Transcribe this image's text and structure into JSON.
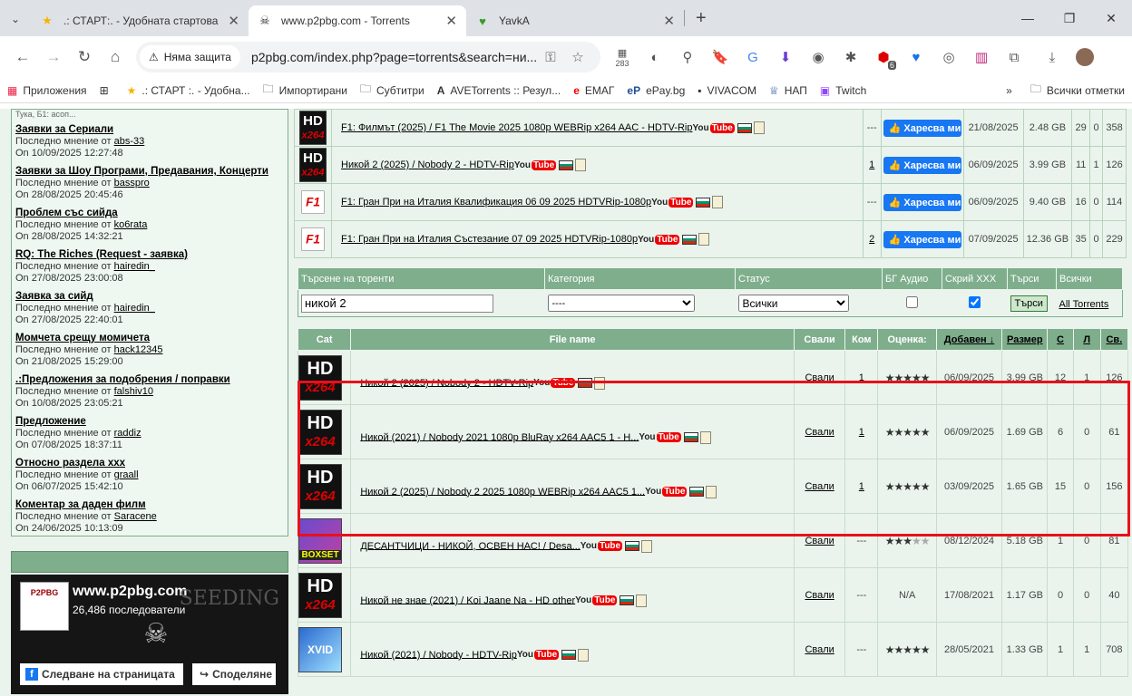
{
  "tabs": [
    {
      "title": ".: СТАРТ:. - Удобната стартова",
      "icon": "star-icon"
    },
    {
      "title": "www.p2pbg.com - Torrents",
      "icon": "pirate-icon"
    },
    {
      "title": "YavkA",
      "icon": "yavka-icon"
    }
  ],
  "toolbar": {
    "security": "Няма защита",
    "url": "p2pbg.com/index.php?page=torrents&search=ни...",
    "ext_badge_1": "283",
    "ext_badge_2": "6"
  },
  "bookmarks": [
    "Приложения",
    ".: СТАРТ :. - Удобна...",
    "Импортирани",
    "Субтитри",
    "AVETorrents :: Резул...",
    "ЕМАГ",
    "ePay.bg",
    "VIVACOM",
    "НАП",
    "Twitch",
    "Всички отметки"
  ],
  "forum": [
    {
      "title": "Заявки за Сериали",
      "prefix": "Последно мнение от",
      "user": "abs-33",
      "date": "On 10/09/2025 12:27:48"
    },
    {
      "title": "Заявки за Шоу Програми, Предавания, Концерти",
      "prefix": "Последно мнение от",
      "user": "basspro",
      "date": "On 28/08/2025 20:45:46"
    },
    {
      "title": "Проблем със сийда",
      "prefix": "Последно мнение от",
      "user": "ko6rata",
      "date": "On 28/08/2025 14:32:21"
    },
    {
      "title": "RQ: The Riches (Request - заявка)",
      "prefix": "Последно мнение от",
      "user": "hairedin_",
      "date": "On 27/08/2025 23:00:08"
    },
    {
      "title": "Заявка за сийд",
      "prefix": "Последно мнение от",
      "user": "hairedin_",
      "date": "On 27/08/2025 22:40:01"
    },
    {
      "title": "Момчета срещу момичета",
      "prefix": "Последно мнение от",
      "user": "hack12345",
      "date": "On 21/08/2025 15:29:00"
    },
    {
      "title": ".:Предложения за подобрения / поправки",
      "prefix": "Последно мнение от",
      "user": "falshiv10",
      "date": "On 10/08/2025 23:05:21"
    },
    {
      "title": "Предложение",
      "prefix": "Последно мнение от",
      "user": "raddiz",
      "date": "On 07/08/2025 18:37:11"
    },
    {
      "title": "Относно раздела ххх",
      "prefix": "Последно мнение от",
      "user": "graall",
      "date": "On 06/07/2025 15:42:10"
    },
    {
      "title": "Коментар за даден филм",
      "prefix": "Последно мнение от",
      "user": "Saracene",
      "date": "On 24/06/2025 10:13:09"
    }
  ],
  "fb": {
    "site": "www.p2pbg.com",
    "followers": "26,486 последователи",
    "follow": "Следване на страницата",
    "share": "Споделяне",
    "seeding": "SEEDING"
  },
  "top_rows": [
    {
      "name": "F1: Филмът (2025) / F1 The Movie 2025 1080p WEBRip x264 AAC - HDTV-Rip",
      "com": "---",
      "like": "Харесва ми",
      "date": "21/08/2025",
      "size": "2.48 GB",
      "s": "29",
      "l": "0",
      "d": "358",
      "cat": "hd"
    },
    {
      "name": "Никой 2 (2025) / Nobody 2 - HDTV-Rip",
      "com": "1",
      "like": "Харесва ми",
      "date": "06/09/2025",
      "size": "3.99 GB",
      "s": "11",
      "l": "1",
      "d": "126",
      "cat": "hd"
    },
    {
      "name": "F1: Гран При на Италия Квалификация 06 09 2025 HDTVRip-1080p",
      "com": "---",
      "like": "Харесва ми",
      "date": "06/09/2025",
      "size": "9.40 GB",
      "s": "16",
      "l": "0",
      "d": "114",
      "cat": "f1"
    },
    {
      "name": "F1: Гран При на Италия Състезание 07 09 2025 HDTVRip-1080p",
      "com": "2",
      "like": "Харесва ми",
      "date": "07/09/2025",
      "size": "12.36 GB",
      "s": "35",
      "l": "0",
      "d": "229",
      "cat": "f1"
    }
  ],
  "search": {
    "headers": [
      "Търсене на торенти",
      "Категория",
      "Статус",
      "БГ Аудио",
      "Скрий XXX",
      "Търси",
      "Всички"
    ],
    "query": "никой 2",
    "category": "----",
    "status": "Всички",
    "bg_audio": false,
    "hide_xxx": true,
    "button": "Търси",
    "all": "All Torrents"
  },
  "results_headers": [
    "Cat",
    "File name",
    "Свали",
    "Ком",
    "Оценка:",
    "Добавен ↓",
    "Размер",
    "С",
    "Л",
    "Св."
  ],
  "results": [
    {
      "cat": "hd",
      "name": "Никой 2 (2025) / Nobody 2 - HDTV-Rip",
      "dl": "Свали",
      "com": "1",
      "rating": 5,
      "date": "06/09/2025",
      "size": "3.99 GB",
      "s": "12",
      "l": "1",
      "d": "126"
    },
    {
      "cat": "hd",
      "name": "Никой (2021) / Nobody 2021 1080p BluRay x264 AAC5 1 - H...",
      "dl": "Свали",
      "com": "1",
      "rating": 5,
      "date": "06/09/2025",
      "size": "1.69 GB",
      "s": "6",
      "l": "0",
      "d": "61"
    },
    {
      "cat": "hd",
      "name": "Никой 2 (2025) / Nobody 2 2025 1080p WEBRip x264 AAC5 1...",
      "dl": "Свали",
      "com": "1",
      "rating": 5,
      "date": "03/09/2025",
      "size": "1.65 GB",
      "s": "15",
      "l": "0",
      "d": "156"
    },
    {
      "cat": "boxset",
      "name": "ДЕСАНТЧИЦИ - НИКОЙ, ОСВЕН НАС! / Desa...",
      "dl": "Свали",
      "com": "---",
      "rating": 3,
      "date": "08/12/2024",
      "size": "5.18 GB",
      "s": "1",
      "l": "0",
      "d": "81"
    },
    {
      "cat": "hd",
      "name": "Никой не знае (2021) / Koi Jaane Na - HD other",
      "dl": "Свали",
      "com": "---",
      "rating": null,
      "rating_text": "N/A",
      "date": "17/08/2021",
      "size": "1.17 GB",
      "s": "0",
      "l": "0",
      "d": "40"
    },
    {
      "cat": "xvid",
      "name": "Никой (2021) / Nobody - HDTV-Rip",
      "dl": "Свали",
      "com": "---",
      "rating": 5,
      "date": "28/05/2021",
      "size": "1.33 GB",
      "s": "1",
      "l": "1",
      "d": "708"
    }
  ],
  "partial_header": "Тука, Б1: асоп...",
  "badge_icons": {
    "youtube": "YouTube",
    "colors": {
      "accent": "#7fae8d",
      "highlight": "#e8101a",
      "fb": "#1877f2"
    }
  }
}
